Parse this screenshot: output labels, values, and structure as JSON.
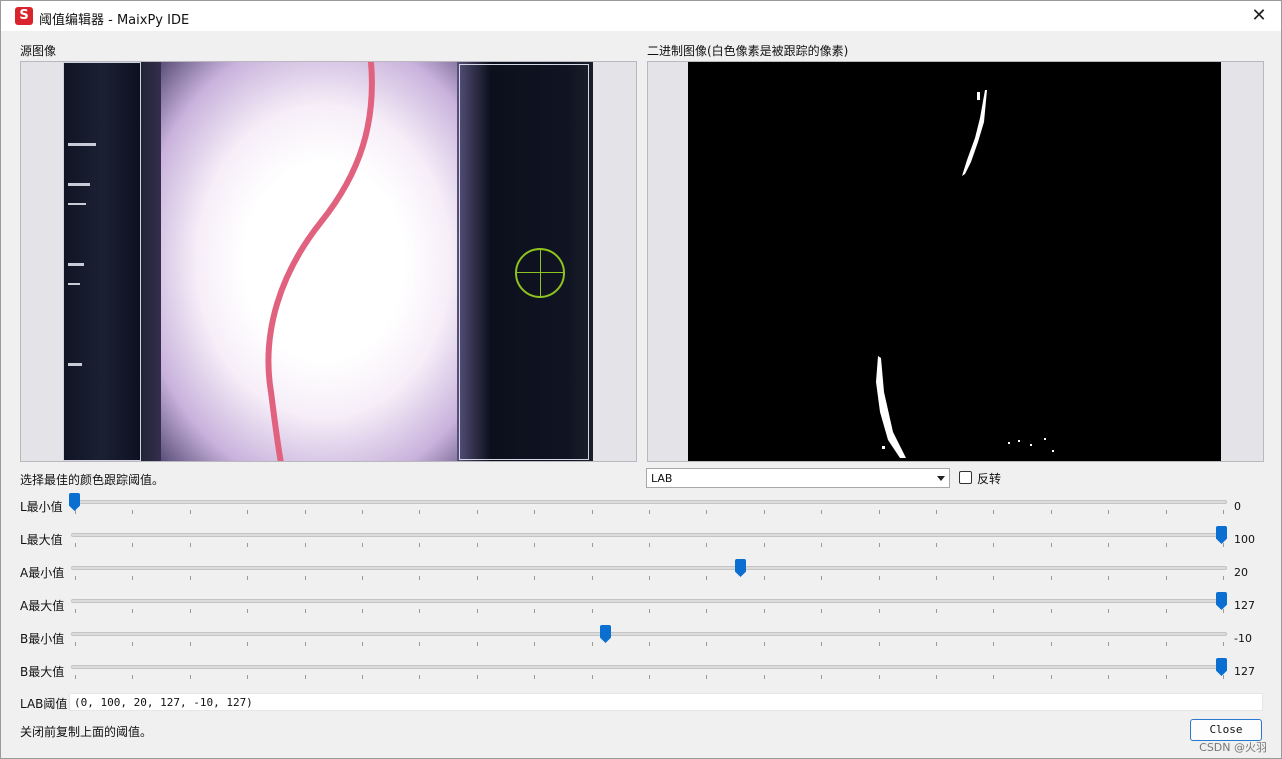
{
  "window": {
    "app_icon_letter": "S",
    "title": "阈值编辑器 - MaixPy IDE",
    "close_glyph": "✕"
  },
  "panels": {
    "source_label": "源图像",
    "binary_label": "二进制图像(白色像素是被跟踪的像素)"
  },
  "instructions": "选择最佳的颜色跟踪阈值。",
  "color_space": {
    "selected": "LAB",
    "invert_label": "反转",
    "invert_checked": false
  },
  "sliders": [
    {
      "label": "L最小值",
      "value": "0",
      "min": 0,
      "max": 100,
      "num": 0
    },
    {
      "label": "L最大值",
      "value": "100",
      "min": 0,
      "max": 100,
      "num": 100
    },
    {
      "label": "A最小值",
      "value": "20",
      "min": -128,
      "max": 127,
      "num": 20
    },
    {
      "label": "A最大值",
      "value": "127",
      "min": -128,
      "max": 127,
      "num": 127
    },
    {
      "label": "B最小值",
      "value": "-10",
      "min": -128,
      "max": 127,
      "num": -10
    },
    {
      "label": "B最大值",
      "value": "127",
      "min": -128,
      "max": 127,
      "num": 127
    }
  ],
  "result": {
    "label": "LAB阈值",
    "value": "(0, 100, 20, 127, -10, 127)"
  },
  "footer": {
    "note": "关闭前复制上面的阈值。",
    "close_button": "Close",
    "watermark": "CSDN @火羽"
  },
  "colors": {
    "accent": "#0a6fd1",
    "crosshair": "#8ec21e",
    "app_icon": "#d9232d"
  }
}
